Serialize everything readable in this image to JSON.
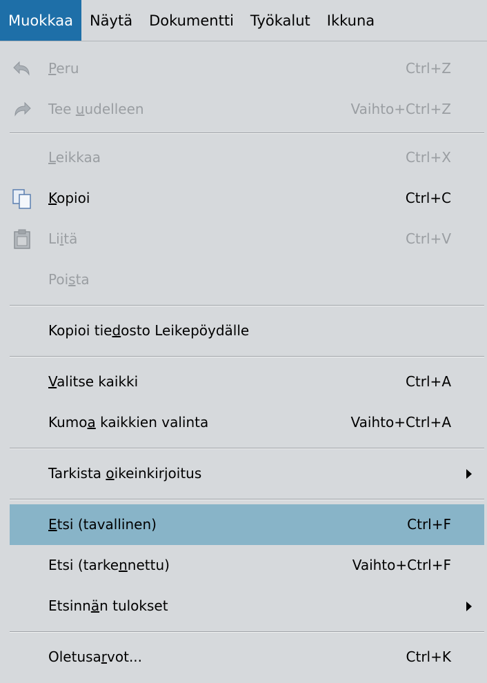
{
  "menubar": {
    "items": [
      {
        "label": "Muokkaa"
      },
      {
        "label": "Näytä"
      },
      {
        "label": "Dokumentti"
      },
      {
        "label": "Työkalut"
      },
      {
        "label": "Ikkuna"
      }
    ]
  },
  "menu": {
    "undo": {
      "label_pre": "",
      "label_u": "P",
      "label_post": "eru",
      "shortcut": "Ctrl+Z"
    },
    "redo": {
      "label_pre": "Tee ",
      "label_u": "u",
      "label_post": "udelleen",
      "shortcut": "Vaihto+Ctrl+Z"
    },
    "cut": {
      "label_pre": "",
      "label_u": "L",
      "label_post": "eikkaa",
      "shortcut": "Ctrl+X"
    },
    "copy": {
      "label_pre": "",
      "label_u": "K",
      "label_post": "opioi",
      "shortcut": "Ctrl+C"
    },
    "paste": {
      "label_pre": "Li",
      "label_u": "i",
      "label_post": "tä",
      "shortcut": "Ctrl+V"
    },
    "delete": {
      "label_pre": "Poi",
      "label_u": "s",
      "label_post": "ta",
      "shortcut": ""
    },
    "copy_file": {
      "label_pre": "Kopioi tie",
      "label_u": "d",
      "label_post": "osto Leikepöydälle",
      "shortcut": ""
    },
    "select_all": {
      "label_pre": "",
      "label_u": "V",
      "label_post": "alitse kaikki",
      "shortcut": "Ctrl+A"
    },
    "deselect_all": {
      "label_pre": "Kumo",
      "label_u": "a",
      "label_post": " kaikkien valinta",
      "shortcut": "Vaihto+Ctrl+A"
    },
    "spellcheck": {
      "label_pre": "Tarkista ",
      "label_u": "o",
      "label_post": "ikeinkirjoitus",
      "shortcut": ""
    },
    "find": {
      "label_pre": "",
      "label_u": "E",
      "label_post": "tsi (tavallinen)",
      "shortcut": "Ctrl+F"
    },
    "find_advanced": {
      "label_pre": "Etsi (tarke",
      "label_u": "n",
      "label_post": "nettu)",
      "shortcut": "Vaihto+Ctrl+F"
    },
    "search_results": {
      "label_pre": "Etsinn",
      "label_u": "ä",
      "label_post": "n tulokset",
      "shortcut": ""
    },
    "preferences": {
      "label_pre": "Oletusa",
      "label_u": "r",
      "label_post": "vot...",
      "shortcut": "Ctrl+K"
    }
  }
}
